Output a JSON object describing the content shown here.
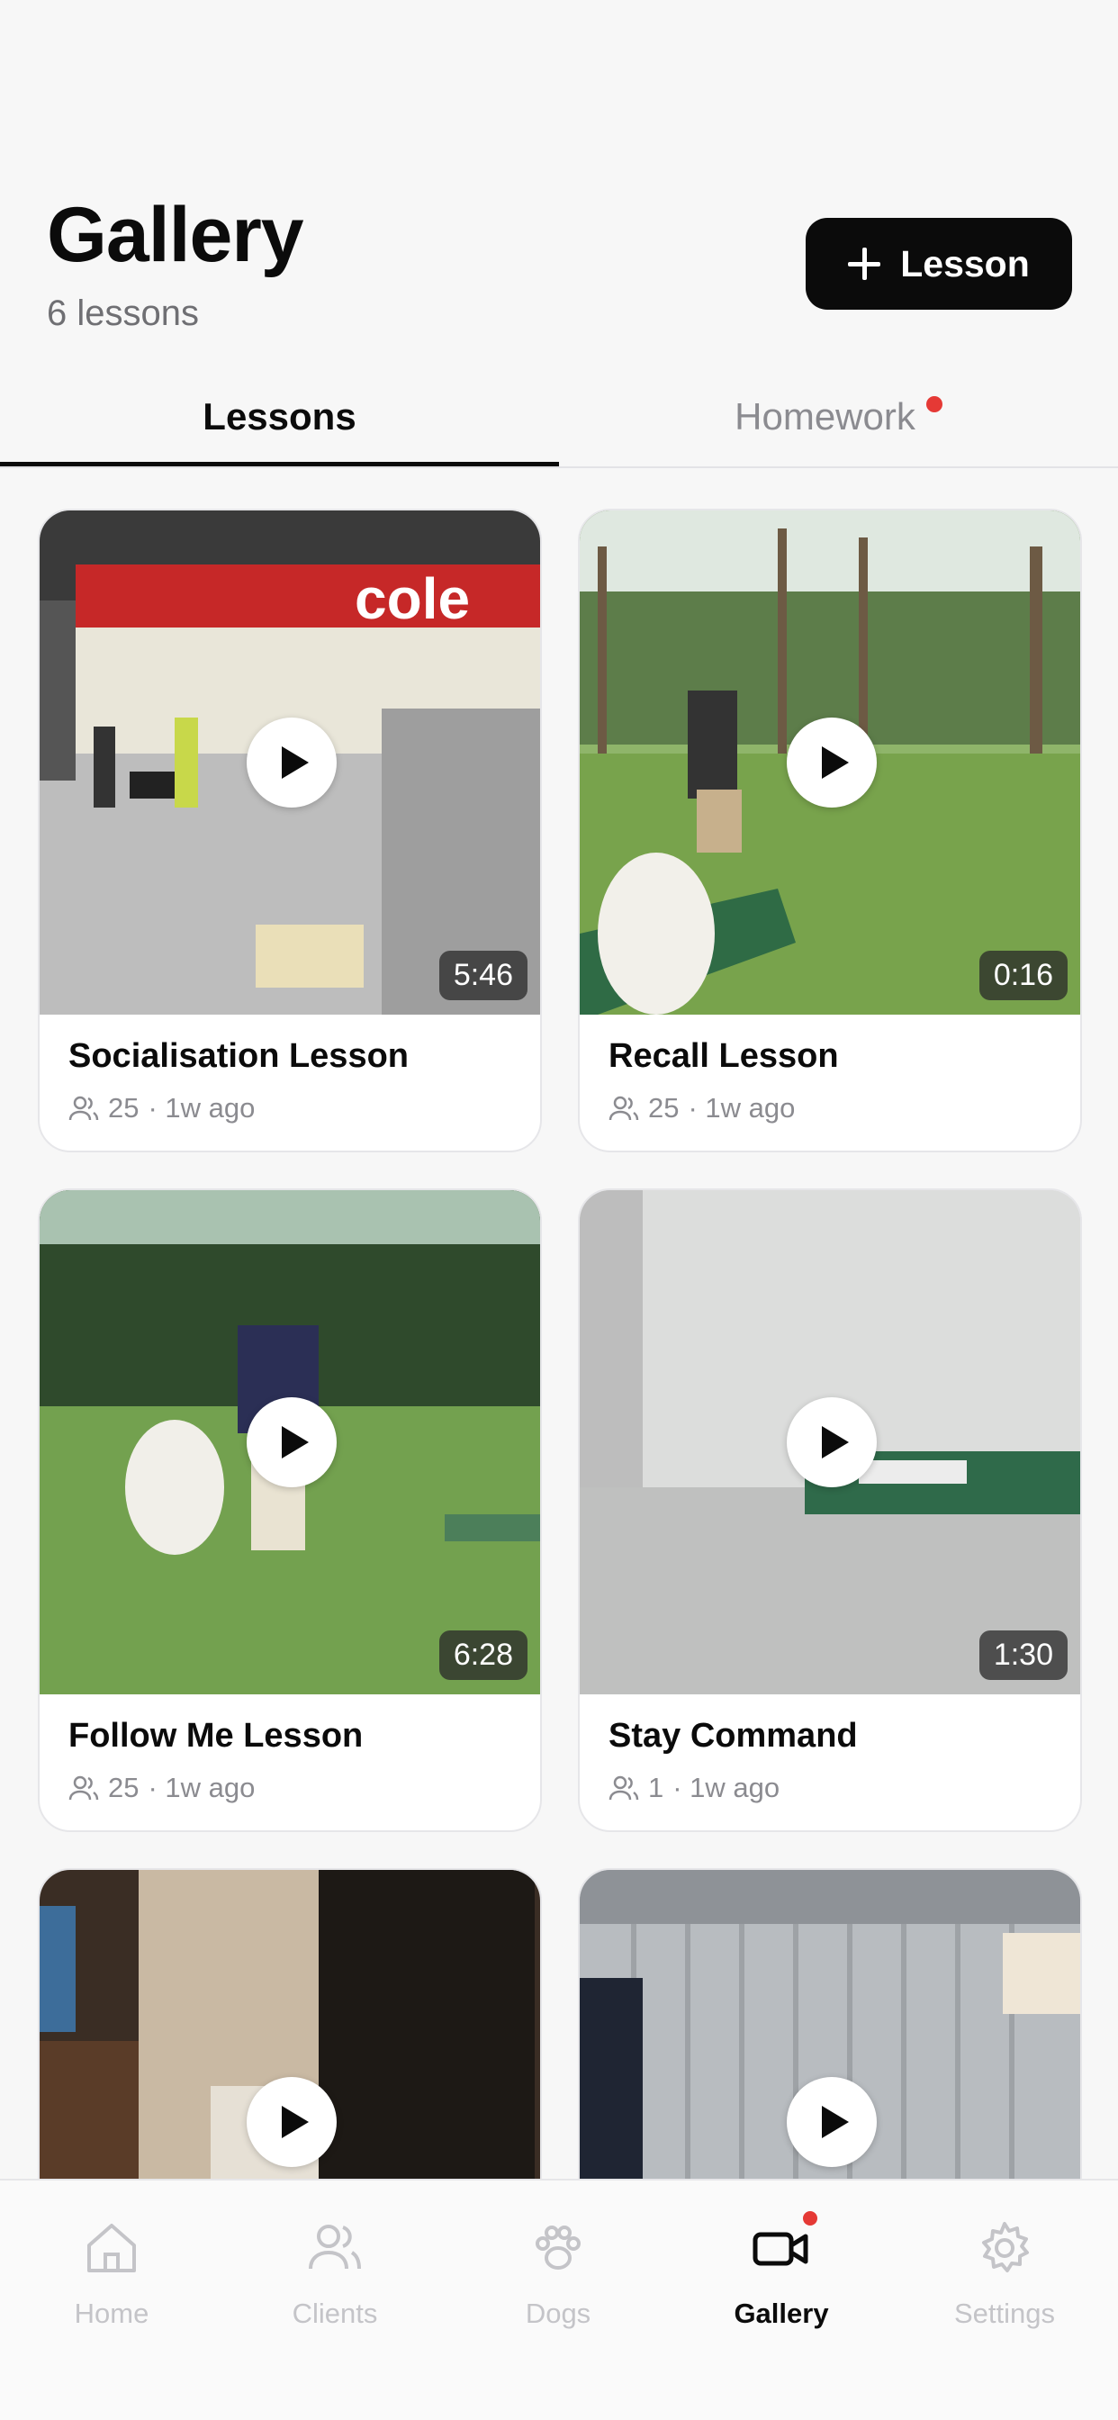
{
  "header": {
    "title": "Gallery",
    "subtitle": "6 lessons",
    "add_button_label": "Lesson"
  },
  "tabs": [
    {
      "label": "Lessons",
      "active": true,
      "has_badge": false
    },
    {
      "label": "Homework",
      "active": false,
      "has_badge": true
    }
  ],
  "lessons": [
    {
      "title": "Socialisation Lesson",
      "viewers": "25",
      "meta": "· 1w ago",
      "duration": "5:46"
    },
    {
      "title": "Recall Lesson",
      "viewers": "25",
      "meta": "· 1w ago",
      "duration": "0:16"
    },
    {
      "title": "Follow Me Lesson",
      "viewers": "25",
      "meta": "· 1w ago",
      "duration": "6:28"
    },
    {
      "title": "Stay Command",
      "viewers": "1",
      "meta": "· 1w ago",
      "duration": "1:30"
    },
    {
      "title": "",
      "viewers": "",
      "meta": "",
      "duration": ""
    },
    {
      "title": "",
      "viewers": "",
      "meta": "",
      "duration": ""
    }
  ],
  "tab_bar": [
    {
      "label": "Home",
      "icon": "home-icon",
      "active": false
    },
    {
      "label": "Clients",
      "icon": "users-icon",
      "active": false
    },
    {
      "label": "Dogs",
      "icon": "paw-icon",
      "active": false
    },
    {
      "label": "Gallery",
      "icon": "video-icon",
      "active": true
    },
    {
      "label": "Settings",
      "icon": "gear-icon",
      "active": false
    }
  ],
  "colors": {
    "accent": "#0b0b0b",
    "badge": "#e53935",
    "muted": "#8b8b90"
  }
}
